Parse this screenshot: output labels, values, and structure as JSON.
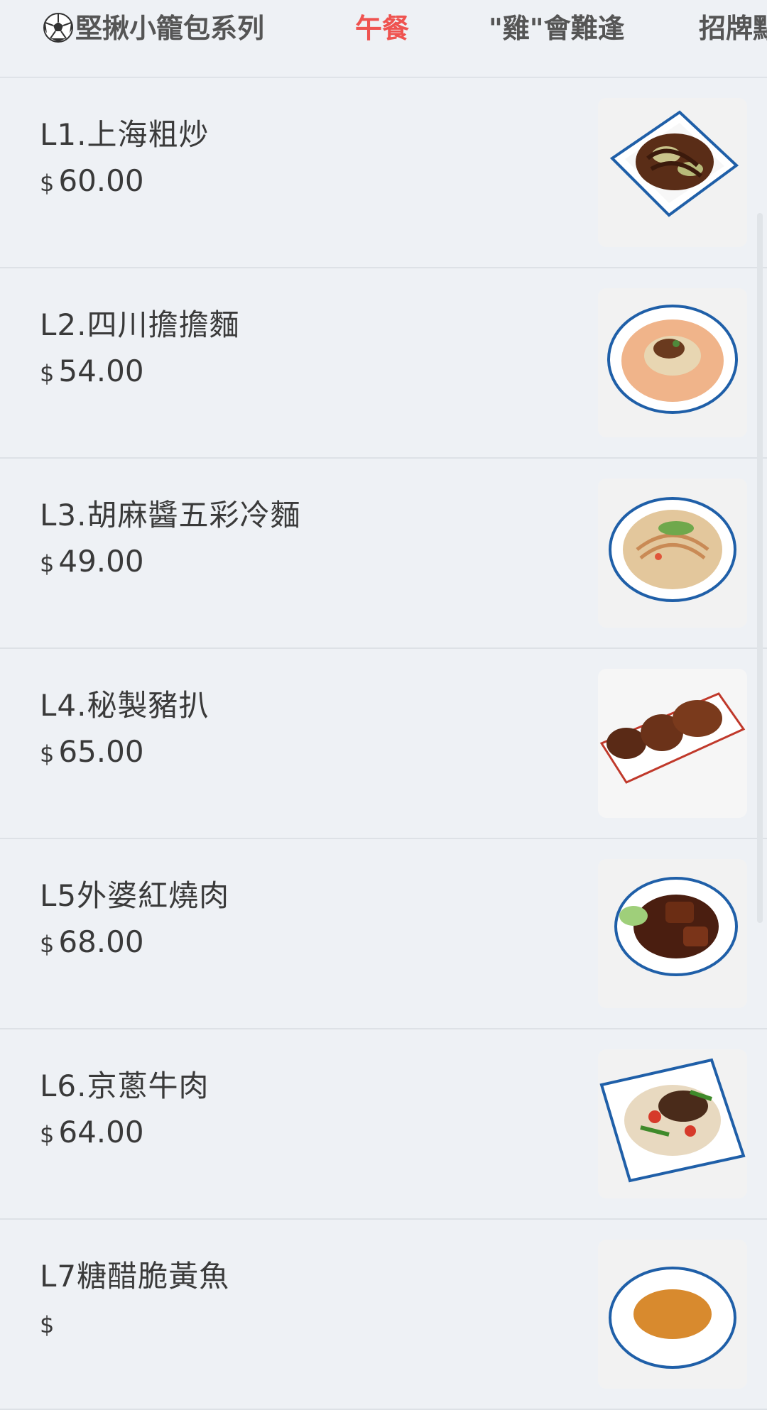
{
  "tabs": [
    {
      "label": "堅揪小籠包系列",
      "icon": "soccer-ball-icon",
      "active": false
    },
    {
      "label": "午餐",
      "active": true
    },
    {
      "label": "\"雞\"會難逢",
      "active": false
    },
    {
      "label": "招牌點",
      "active": false
    }
  ],
  "items": [
    {
      "name": "L1.上海粗炒",
      "currency": "$",
      "price": "60.00",
      "dish": "stir-fried-noodles"
    },
    {
      "name": "L2.四川擔擔麵",
      "currency": "$",
      "price": "54.00",
      "dish": "dandan-noodles"
    },
    {
      "name": "L3.胡麻醬五彩冷麵",
      "currency": "$",
      "price": "49.00",
      "dish": "cold-noodles"
    },
    {
      "name": "L4.秘製豬扒",
      "currency": "$",
      "price": "65.00",
      "dish": "pork-chop"
    },
    {
      "name": "L5外婆紅燒肉",
      "currency": "$",
      "price": "68.00",
      "dish": "braised-pork"
    },
    {
      "name": "L6.京蔥牛肉",
      "currency": "$",
      "price": "64.00",
      "dish": "beef-scallion"
    },
    {
      "name": "L7糖醋脆黃魚",
      "currency": "$",
      "price": "",
      "dish": "sweet-sour-fish"
    }
  ],
  "colors": {
    "active_tab": "#ef5350",
    "background": "#eef1f5"
  }
}
